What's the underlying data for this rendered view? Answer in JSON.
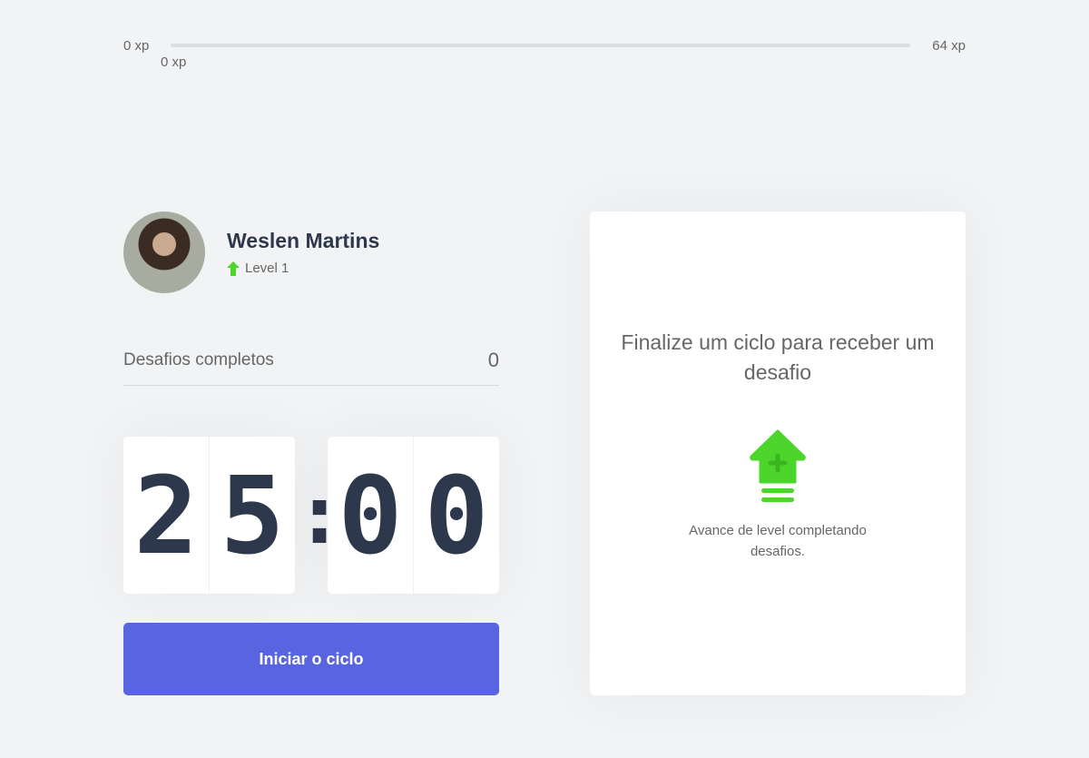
{
  "xp": {
    "min_label": "0 xp",
    "max_label": "64 xp",
    "current_label": "0 xp",
    "progress_percent": 0,
    "accent": "#4cd62b"
  },
  "profile": {
    "name": "Weslen Martins",
    "level": "Level 1"
  },
  "challenges": {
    "label": "Desafios completos",
    "count": "0"
  },
  "timer": {
    "m1": "2",
    "m2": "5",
    "sep": ":",
    "s1": "0",
    "s2": "0"
  },
  "button": {
    "label": "Iniciar o ciclo",
    "color": "#5965e0"
  },
  "card": {
    "title": "Finalize um ciclo para receber um desafio",
    "icon": "level-up-icon",
    "text": "Avance de level completando desafios."
  }
}
